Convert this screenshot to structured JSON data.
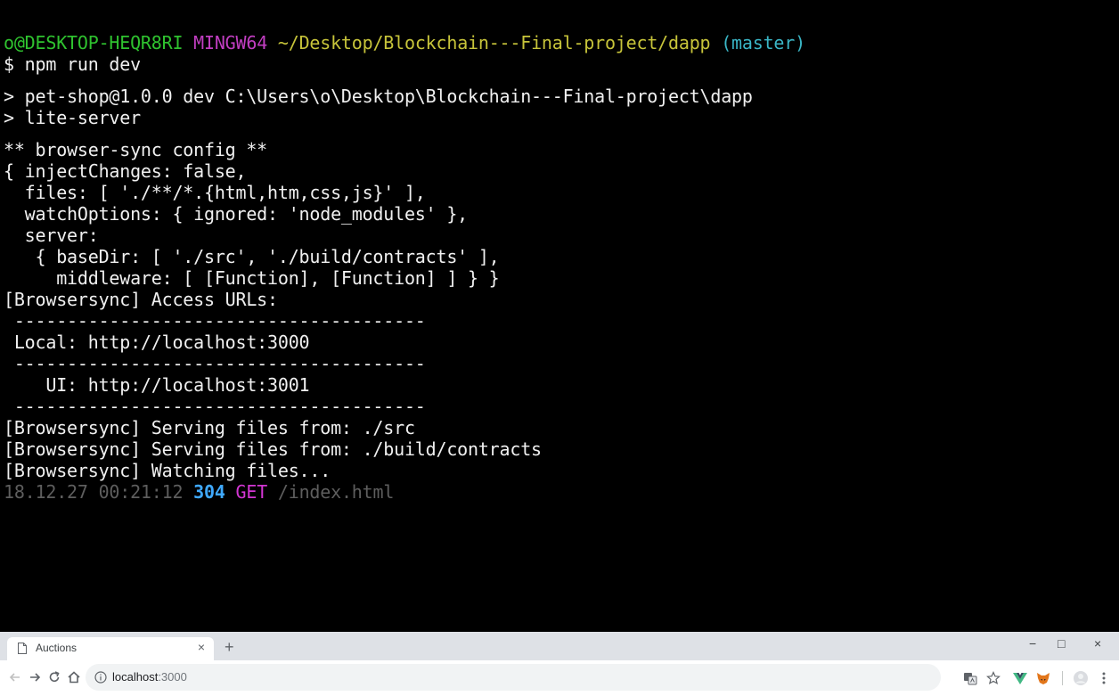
{
  "terminal": {
    "prompt": {
      "user_host": "o@DESKTOP-HEQR8RI",
      "env": "MINGW64",
      "path": "~/Desktop/Blockchain---Final-project/dapp",
      "branch": "(master)"
    },
    "command": "$ npm run dev",
    "script_line1": "> pet-shop@1.0.0 dev C:\\Users\\o\\Desktop\\Blockchain---Final-project\\dapp",
    "script_line2": "> lite-server",
    "config": [
      "** browser-sync config **",
      "{ injectChanges: false,",
      "  files: [ './**/*.{html,htm,css,js}' ],",
      "  watchOptions: { ignored: 'node_modules' },",
      "  server:",
      "   { baseDir: [ './src', './build/contracts' ],",
      "     middleware: [ [Function], [Function] ] } }"
    ],
    "access_urls": "[Browsersync] Access URLs:",
    "divider": " ---------------------------------------",
    "local": " Local: http://localhost:3000",
    "ui": "    UI: http://localhost:3001",
    "serving1": "[Browsersync] Serving files from: ./src",
    "serving2": "[Browsersync] Serving files from: ./build/contracts",
    "watching": "[Browsersync] Watching files...",
    "log": {
      "timestamp": "18.12.27 00:21:12",
      "status": "304",
      "method": "GET",
      "path": "/index.html"
    }
  },
  "browser": {
    "tab_title": "Auctions",
    "tab_close": "×",
    "new_tab": "+",
    "url_host": "localhost",
    "url_port": ":3000",
    "window_controls": [
      "−",
      "□",
      "×"
    ]
  }
}
